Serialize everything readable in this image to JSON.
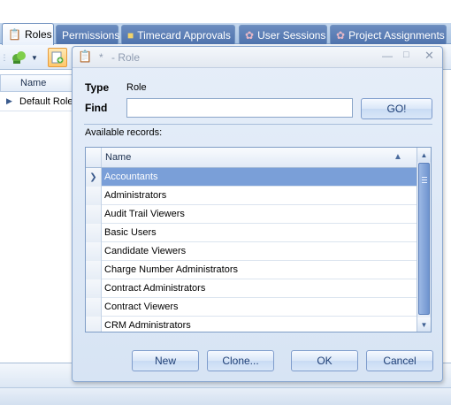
{
  "tabs": [
    {
      "label": "Roles",
      "icon": "roles-icon",
      "active": true
    },
    {
      "label": "Permissions",
      "icon": "",
      "active": false
    },
    {
      "label": "Timecard Approvals",
      "icon": "timecard-icon",
      "active": false
    },
    {
      "label": "User Sessions",
      "icon": "user-sessions-icon",
      "active": false
    },
    {
      "label": "Project Assignments",
      "icon": "project-assignments-icon",
      "active": false
    }
  ],
  "background_grid": {
    "header": "Name",
    "row": "Default Role"
  },
  "dialog": {
    "title_star": "*",
    "title": "- Role",
    "type_label": "Type",
    "type_value": "Role",
    "find_label": "Find",
    "find_value": "",
    "go_label": "GO!",
    "available_label": "Available records:",
    "column_header": "Name",
    "rows": [
      "Accountants",
      "Administrators",
      "Audit Trail Viewers",
      "Basic Users",
      "Candidate Viewers",
      "Charge Number Administrators",
      "Contract Administrators",
      "Contract Viewers",
      "CRM Administrators"
    ],
    "selected_row": 0,
    "buttons": {
      "new": "New",
      "clone": "Clone...",
      "ok": "OK",
      "cancel": "Cancel"
    }
  },
  "colors": {
    "tab_inactive": "#5d7fb7",
    "selection": "#7a9fd8",
    "dialog_bg": "#dfe8f5"
  }
}
